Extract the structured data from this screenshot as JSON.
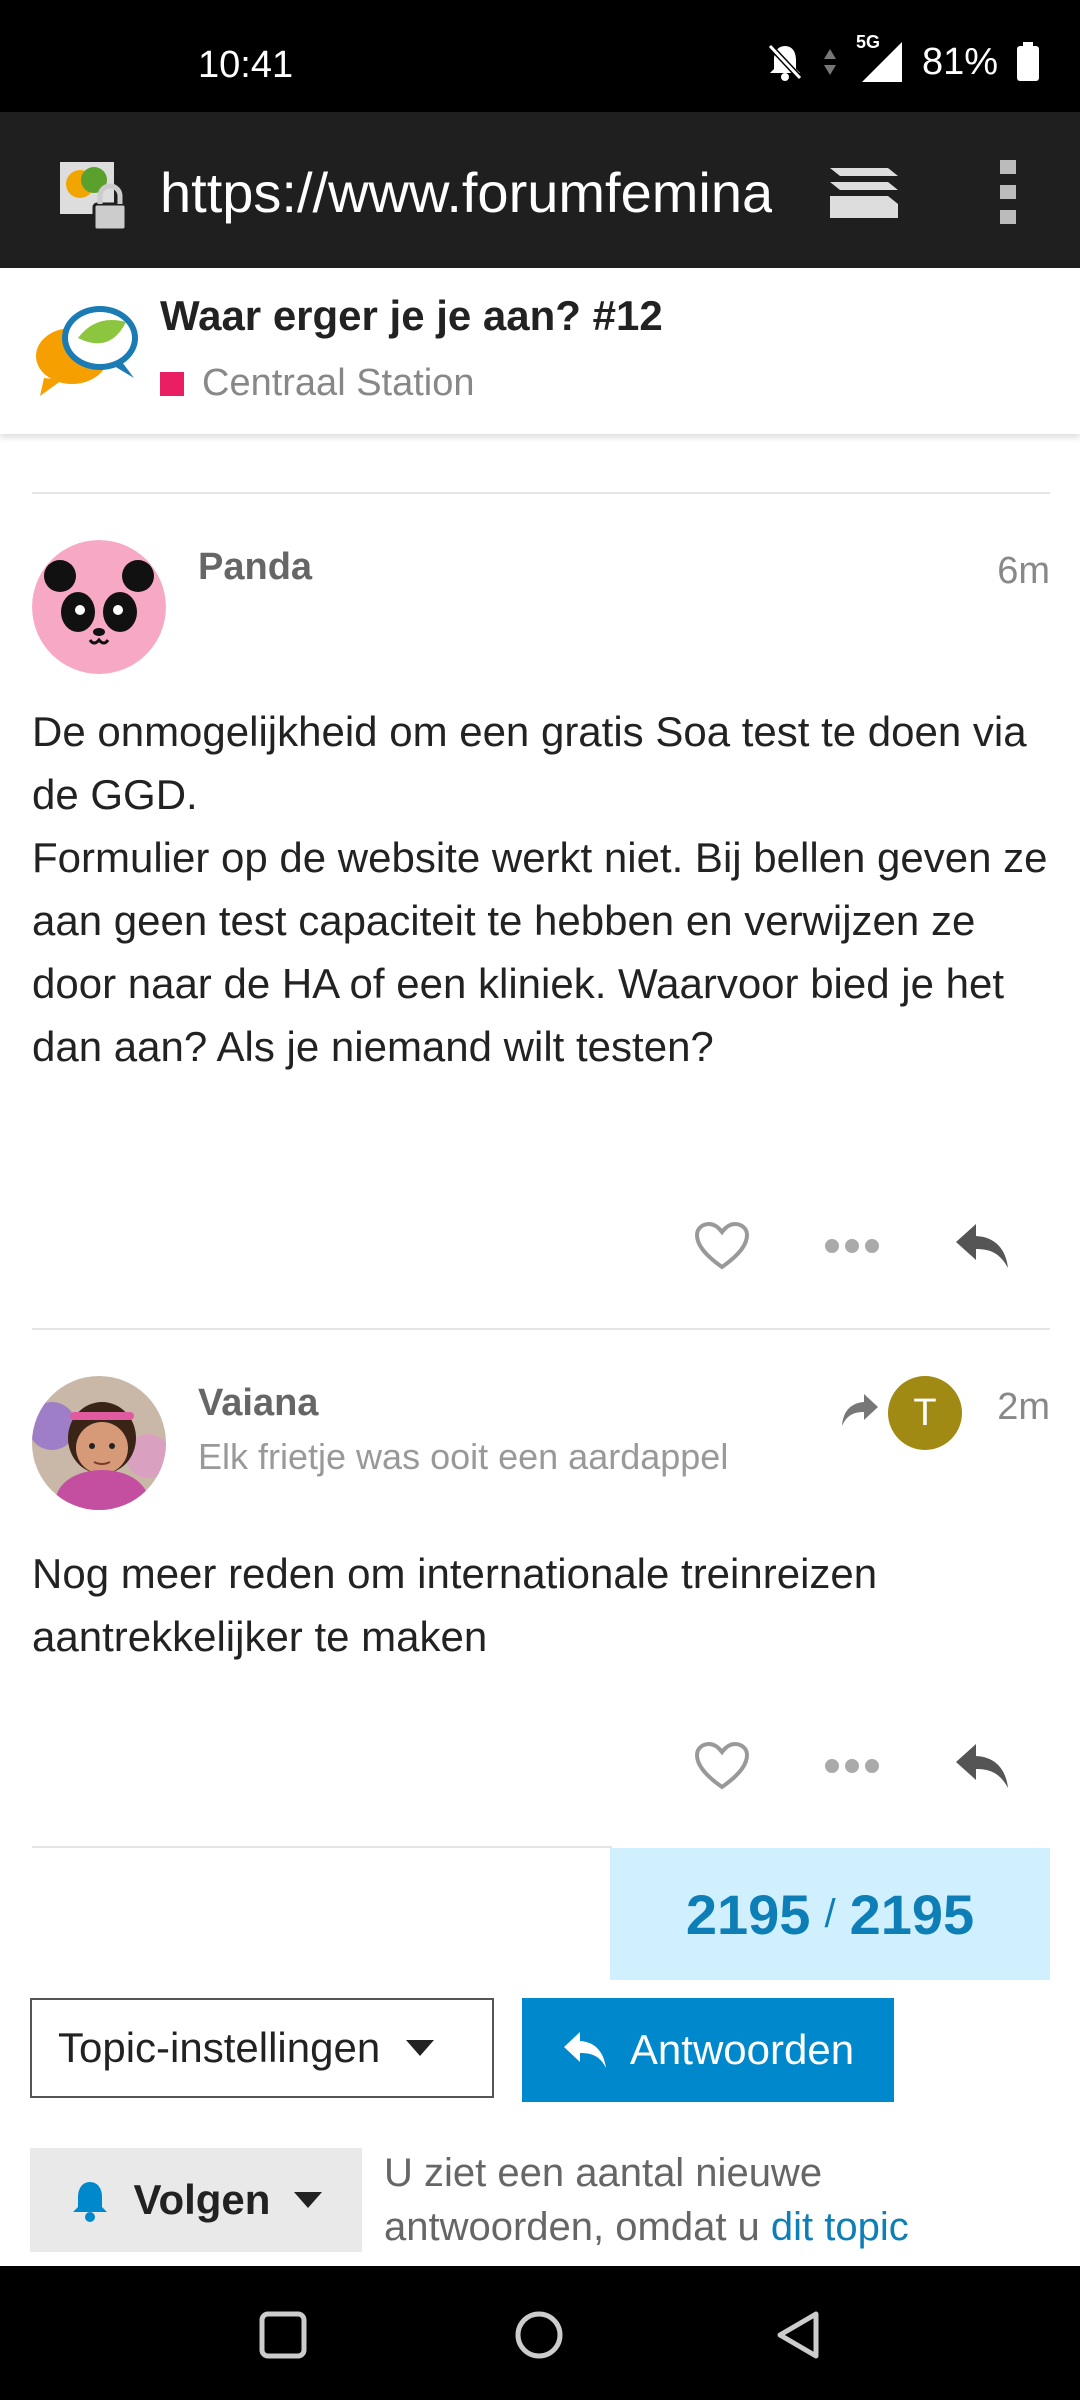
{
  "status_bar": {
    "time": "10:41",
    "network": "5G",
    "battery": "81%",
    "icons": [
      "bell-off-icon",
      "data-arrows-icon",
      "signal-icon",
      "battery-icon"
    ]
  },
  "browser": {
    "url": "https://www.forumfemina",
    "icons": [
      "site-lock-icon",
      "tabs-icon",
      "menu-icon"
    ]
  },
  "topic": {
    "title": "Waar erger je je aan? #12",
    "category": "Centraal Station",
    "category_color": "#e91e63"
  },
  "posts": [
    {
      "username": "Panda",
      "user_title": "",
      "age": "6m",
      "avatar": "panda-avatar",
      "body": "De onmogelijkheid om een gratis Soa test te doen via de GGD.\nFormulier op de website werkt niet. Bij bellen geven ze aan geen test capaciteit te hebben en verwijzen ze door naar de HA of een kliniek. Waarvoor bied je het dan aan? Als je niemand wilt testen?"
    },
    {
      "username": "Vaiana",
      "user_title": "Elk frietje was ooit een aardappel",
      "age": "2m",
      "avatar": "vaiana-avatar",
      "reply_to_avatar_letter": "T",
      "reply_to_avatar_color": "#a08a14",
      "body": "Nog meer reden om internationale treinreizen aantrekkelijker te maken"
    }
  ],
  "progress": {
    "current": "2195",
    "separator": "/",
    "total": "2195"
  },
  "footer": {
    "topic_settings_label": "Topic-instellingen",
    "reply_label": "Antwoorden",
    "follow_label": "Volgen",
    "notice_text": "U ziet een aantal nieuwe antwoorden, omdat u ",
    "notice_link": "dit topic"
  },
  "colors": {
    "accent": "#0088cc",
    "progress_bg": "#d1f0ff",
    "progress_text": "#0e7eb6"
  }
}
